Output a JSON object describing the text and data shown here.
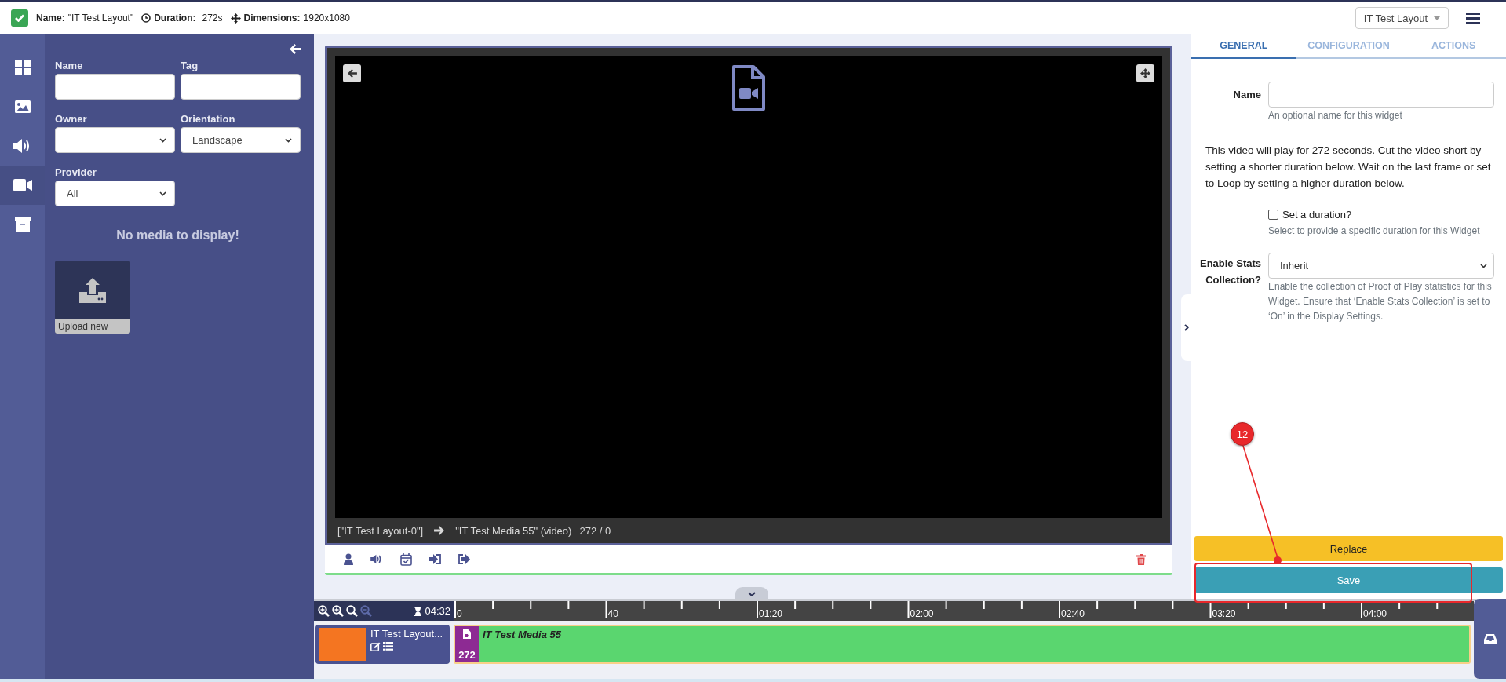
{
  "header": {
    "name_label": "Name:",
    "name_value": "\"IT Test Layout\"",
    "duration_label": "Duration:",
    "duration_value": "272s",
    "dimensions_label": "Dimensions:",
    "dimensions_value": "1920x1080",
    "layout_menu": "IT Test Layout"
  },
  "sidebar": {
    "items": [
      {
        "kind": "layouts",
        "selected": false
      },
      {
        "kind": "images",
        "selected": false
      },
      {
        "kind": "audio",
        "selected": false
      },
      {
        "kind": "video",
        "selected": true
      },
      {
        "kind": "archive",
        "selected": false
      }
    ]
  },
  "library": {
    "filters": [
      {
        "label": "Name",
        "kind": "text"
      },
      {
        "label": "Tag",
        "kind": "text"
      },
      {
        "label": "Owner",
        "kind": "select"
      },
      {
        "label": "Orientation",
        "kind": "select",
        "value": "Landscape"
      },
      {
        "label": "Provider",
        "kind": "select",
        "value": "All"
      }
    ],
    "empty_message": "No media to display!",
    "upload_label": "Upload new"
  },
  "viewer": {
    "region": "[\"IT Test Layout-0\"]",
    "widget": "\"IT Test Media 55\" (video)",
    "counter": "272 / 0"
  },
  "timeline": {
    "total": "04:32",
    "ruler_labels": [
      "0",
      "40",
      "01:20",
      "02:00",
      "02:40",
      "03:20",
      "04:00"
    ],
    "region_name": "IT Test Layout...",
    "widget_name": "IT Test Media 55",
    "widget_duration": "272"
  },
  "properties": {
    "tabs": [
      {
        "label": "GENERAL",
        "selected": true
      },
      {
        "label": "CONFIGURATION",
        "selected": false
      },
      {
        "label": "ACTIONS",
        "selected": false
      }
    ],
    "name_label": "Name",
    "name_help": "An optional name for this widget",
    "description": "This video will play for 272 seconds. Cut the video short by setting a shorter duration below. Wait on the last frame or set to Loop by setting a higher duration below.",
    "duration_checkbox": {
      "label": "Set a duration?",
      "checked": false,
      "help": "Select to provide a specific duration for this Widget"
    },
    "stats_label": "Enable Stats Collection?",
    "stats_value": "Inherit",
    "stats_help": "Enable the collection of Proof of Play statistics for this Widget. Ensure that ‘Enable Stats Collection’ is set to ‘On’ in the Display Settings.",
    "buttons": [
      {
        "label": "Replace",
        "kind": "warning"
      },
      {
        "label": "Save",
        "kind": "primary"
      }
    ]
  },
  "annotation": {
    "number": "12"
  }
}
